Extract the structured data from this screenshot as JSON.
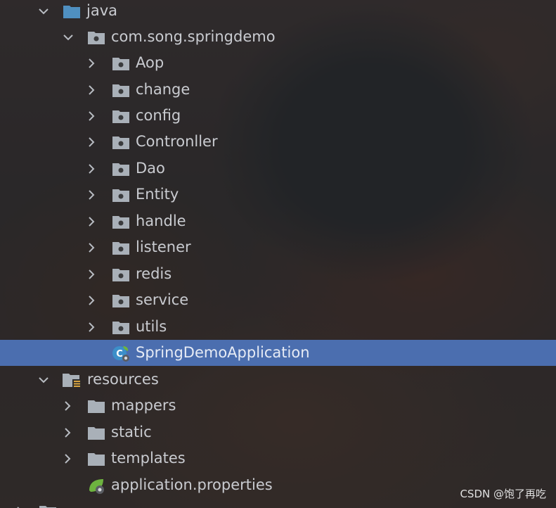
{
  "project_tree": {
    "java": {
      "label": "java",
      "expanded": true,
      "icon": "source-folder-icon"
    },
    "package": {
      "label": "com.song.springdemo",
      "expanded": true,
      "icon": "package-icon"
    },
    "packages": [
      {
        "label": "Aop",
        "icon": "package-folder-icon"
      },
      {
        "label": "change",
        "icon": "package-folder-icon"
      },
      {
        "label": "config",
        "icon": "package-folder-icon"
      },
      {
        "label": "Contronller",
        "icon": "package-folder-icon"
      },
      {
        "label": "Dao",
        "icon": "package-folder-icon"
      },
      {
        "label": "Entity",
        "icon": "package-folder-icon"
      },
      {
        "label": "handle",
        "icon": "package-folder-icon"
      },
      {
        "label": "listener",
        "icon": "package-folder-icon"
      },
      {
        "label": "redis",
        "icon": "package-folder-icon"
      },
      {
        "label": "service",
        "icon": "package-folder-icon"
      },
      {
        "label": "utils",
        "icon": "package-folder-icon"
      }
    ],
    "main_class": {
      "label": "SpringDemoApplication",
      "icon": "spring-boot-class-icon",
      "selected": true
    },
    "resources": {
      "label": "resources",
      "expanded": true,
      "icon": "resources-folder-icon"
    },
    "resource_folders": [
      {
        "label": "mappers",
        "icon": "folder-icon"
      },
      {
        "label": "static",
        "icon": "folder-icon"
      },
      {
        "label": "templates",
        "icon": "folder-icon"
      }
    ],
    "properties_file": {
      "label": "application.properties",
      "icon": "spring-properties-icon"
    }
  },
  "watermark": "CSDN @饱了再吃",
  "colors": {
    "selection": "#4b6eaf",
    "text": "#c9cbd0",
    "folder": "#a9b0b8",
    "source_folder": "#4f8fc0",
    "spring_green": "#6db33f"
  }
}
